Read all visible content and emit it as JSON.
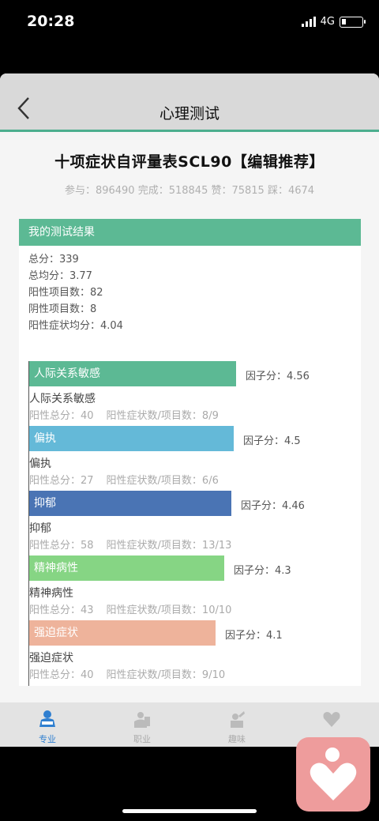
{
  "status": {
    "time": "20:28",
    "network": "4G"
  },
  "nav": {
    "title": "心理测试"
  },
  "test": {
    "title": "十项症状自评量表SCL90【编辑推荐】",
    "stats": "参与：896490 完成：518845 赞：75815 踩：4674"
  },
  "result": {
    "header": "我的测试结果",
    "total": "总分：339",
    "average": "总均分：3.77",
    "positive_items": "阳性项目数：82",
    "negative_items": "阴性项目数：8",
    "positive_avg": "阳性症状均分：4.04"
  },
  "chart_data": {
    "type": "bar",
    "orientation": "horizontal",
    "categories": [
      "人际关系敏感",
      "偏执",
      "抑郁",
      "精神病性",
      "强迫症状"
    ],
    "values": [
      4.56,
      4.5,
      4.46,
      4.3,
      4.1
    ],
    "colors": [
      "#5cb994",
      "#64b9d8",
      "#4a74b4",
      "#86d584",
      "#eeb39b"
    ]
  },
  "factors": [
    {
      "label": "人际关系敏感",
      "score_text": "因子分：4.56",
      "name": "人际关系敏感",
      "pos_total": "阳性总分：40",
      "pos_ratio": "阳性症状数/项目数：8/9"
    },
    {
      "label": "偏执",
      "score_text": "因子分：4.5",
      "name": "偏执",
      "pos_total": "阳性总分：27",
      "pos_ratio": "阳性症状数/项目数：6/6"
    },
    {
      "label": "抑郁",
      "score_text": "因子分：4.46",
      "name": "抑郁",
      "pos_total": "阳性总分：58",
      "pos_ratio": "阳性症状数/项目数：13/13"
    },
    {
      "label": "精神病性",
      "score_text": "因子分：4.3",
      "name": "精神病性",
      "pos_total": "阳性总分：43",
      "pos_ratio": "阳性症状数/项目数：10/10"
    },
    {
      "label": "强迫症状",
      "score_text": "因子分：4.1",
      "name": "强迫症状",
      "pos_total": "阳性总分：40",
      "pos_ratio": "阳性症状数/项目数：9/10"
    }
  ],
  "tabs": [
    {
      "label": "专业",
      "icon": "reader-icon",
      "active": true
    },
    {
      "label": "职业",
      "icon": "briefcase-icon",
      "active": false
    },
    {
      "label": "趣味",
      "icon": "fun-icon",
      "active": false
    },
    {
      "label": "",
      "icon": "heart-icon",
      "active": false
    }
  ]
}
